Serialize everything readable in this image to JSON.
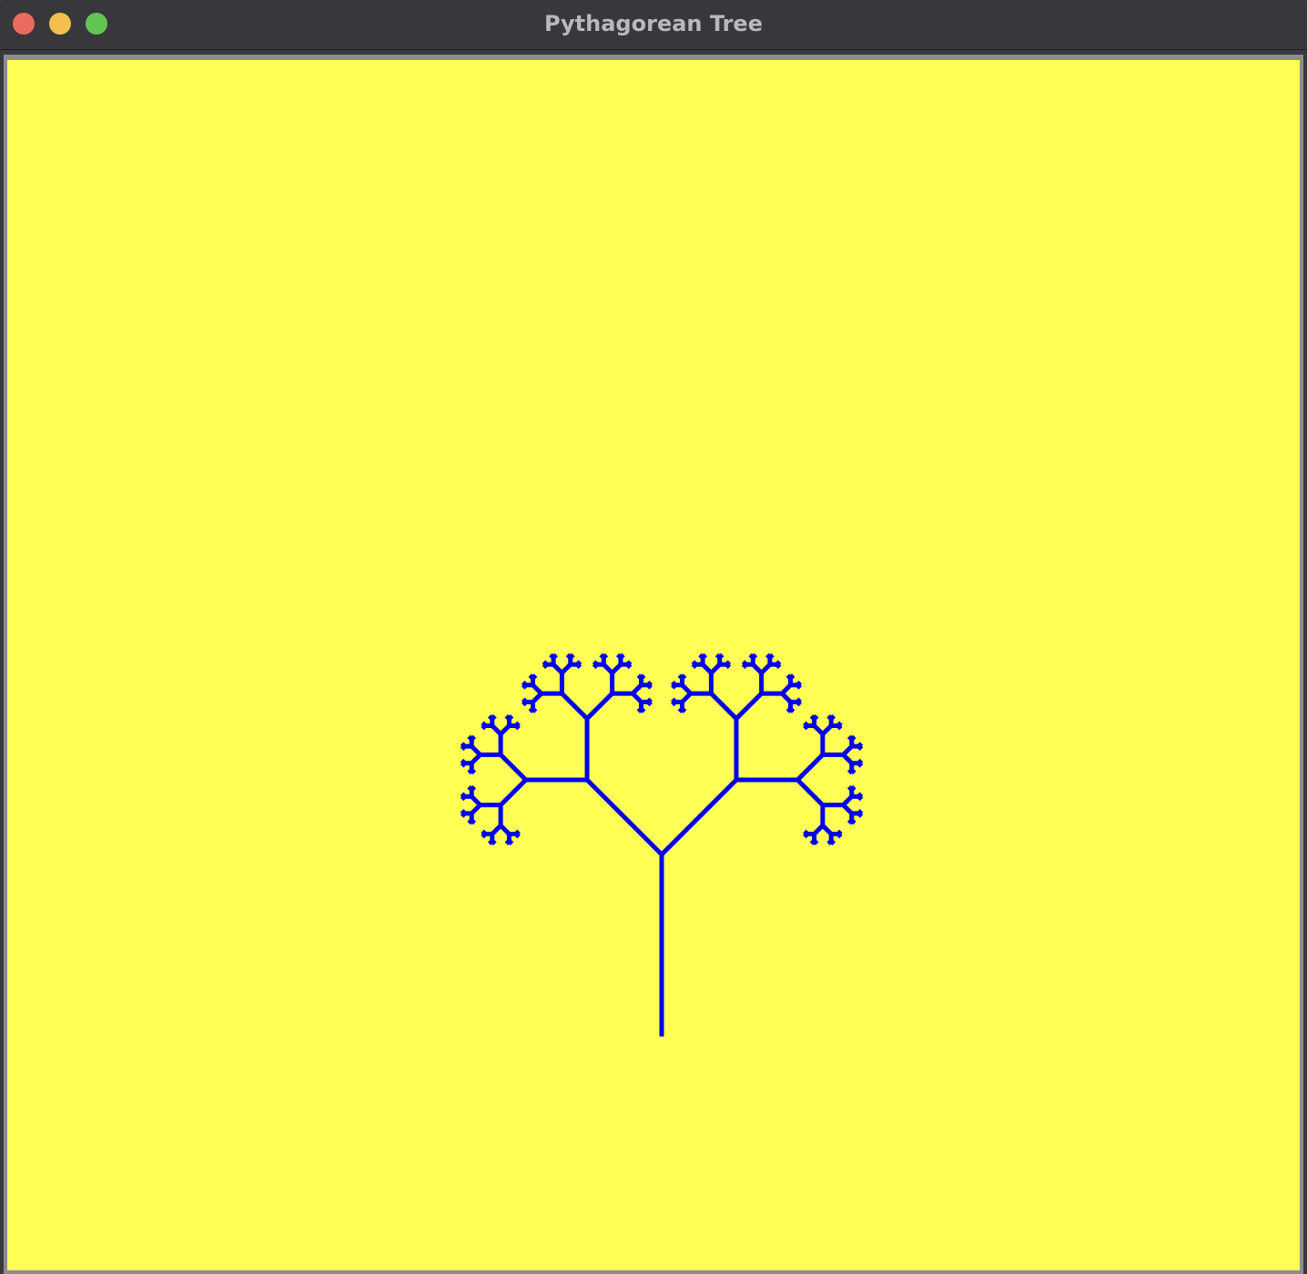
{
  "window": {
    "title": "Pythagorean Tree"
  },
  "controls": {
    "close_color": "#ec6a5e",
    "minimize_color": "#f4bf4f",
    "zoom_color": "#61c554"
  },
  "canvas": {
    "background_color": "#ffff55",
    "line_color": "#0000ee",
    "drawing": "fractal tree",
    "branch_angle_degrees": 45,
    "depth": 7
  }
}
